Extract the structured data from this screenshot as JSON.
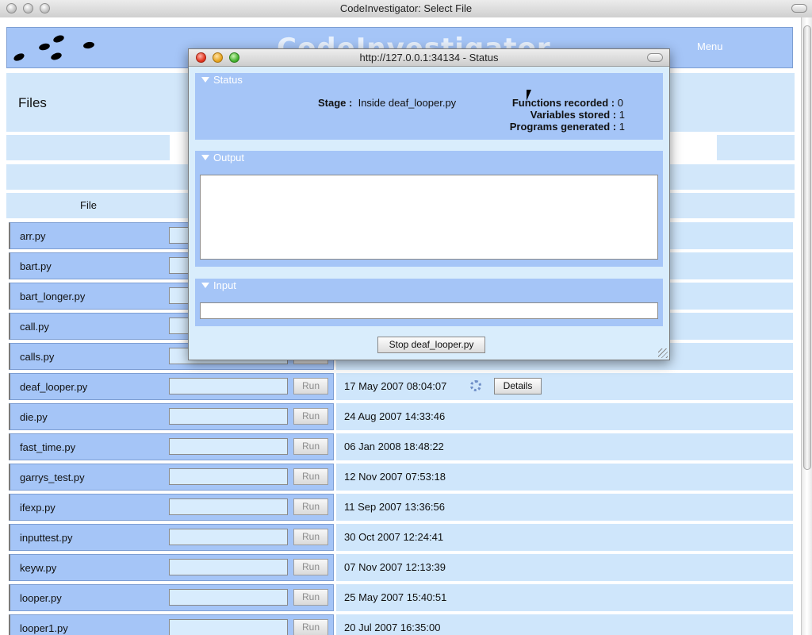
{
  "window": {
    "title": "CodeInvestigator: Select File"
  },
  "banner": {
    "brand": "CodeInvestigator",
    "menu_label": "Menu"
  },
  "files_page": {
    "heading": "Files",
    "file_column_header": "File",
    "run_label": "Run"
  },
  "files": [
    {
      "name": "arr.py",
      "date": ""
    },
    {
      "name": "bart.py",
      "date": ""
    },
    {
      "name": "bart_longer.py",
      "date": ""
    },
    {
      "name": "call.py",
      "date": ""
    },
    {
      "name": "calls.py",
      "date": ""
    },
    {
      "name": "deaf_looper.py",
      "date": "17 May 2007 08:04:07",
      "details_label": "Details"
    },
    {
      "name": "die.py",
      "date": "24 Aug 2007 14:33:46"
    },
    {
      "name": "fast_time.py",
      "date": "06 Jan 2008 18:48:22"
    },
    {
      "name": "garrys_test.py",
      "date": "12 Nov 2007 07:53:18"
    },
    {
      "name": "ifexp.py",
      "date": "11 Sep 2007 13:36:56"
    },
    {
      "name": "inputtest.py",
      "date": "30 Oct 2007 12:24:41"
    },
    {
      "name": "keyw.py",
      "date": "07 Nov 2007 12:13:39"
    },
    {
      "name": "looper.py",
      "date": "25 May 2007 15:40:51"
    },
    {
      "name": "looper1.py",
      "date": "20 Jul 2007 16:35:00"
    }
  ],
  "status_window": {
    "title": "http://127.0.0.1:34134 - Status",
    "status_section": "Status",
    "stage_label": "Stage :",
    "stage_value": "Inside deaf_looper.py",
    "functions_label": "Functions recorded :",
    "functions_value": "0",
    "variables_label": "Variables stored :",
    "variables_value": "1",
    "programs_label": "Programs generated :",
    "programs_value": "1",
    "output_section": "Output",
    "input_section": "Input",
    "stop_label": "Stop deaf_looper.py"
  }
}
